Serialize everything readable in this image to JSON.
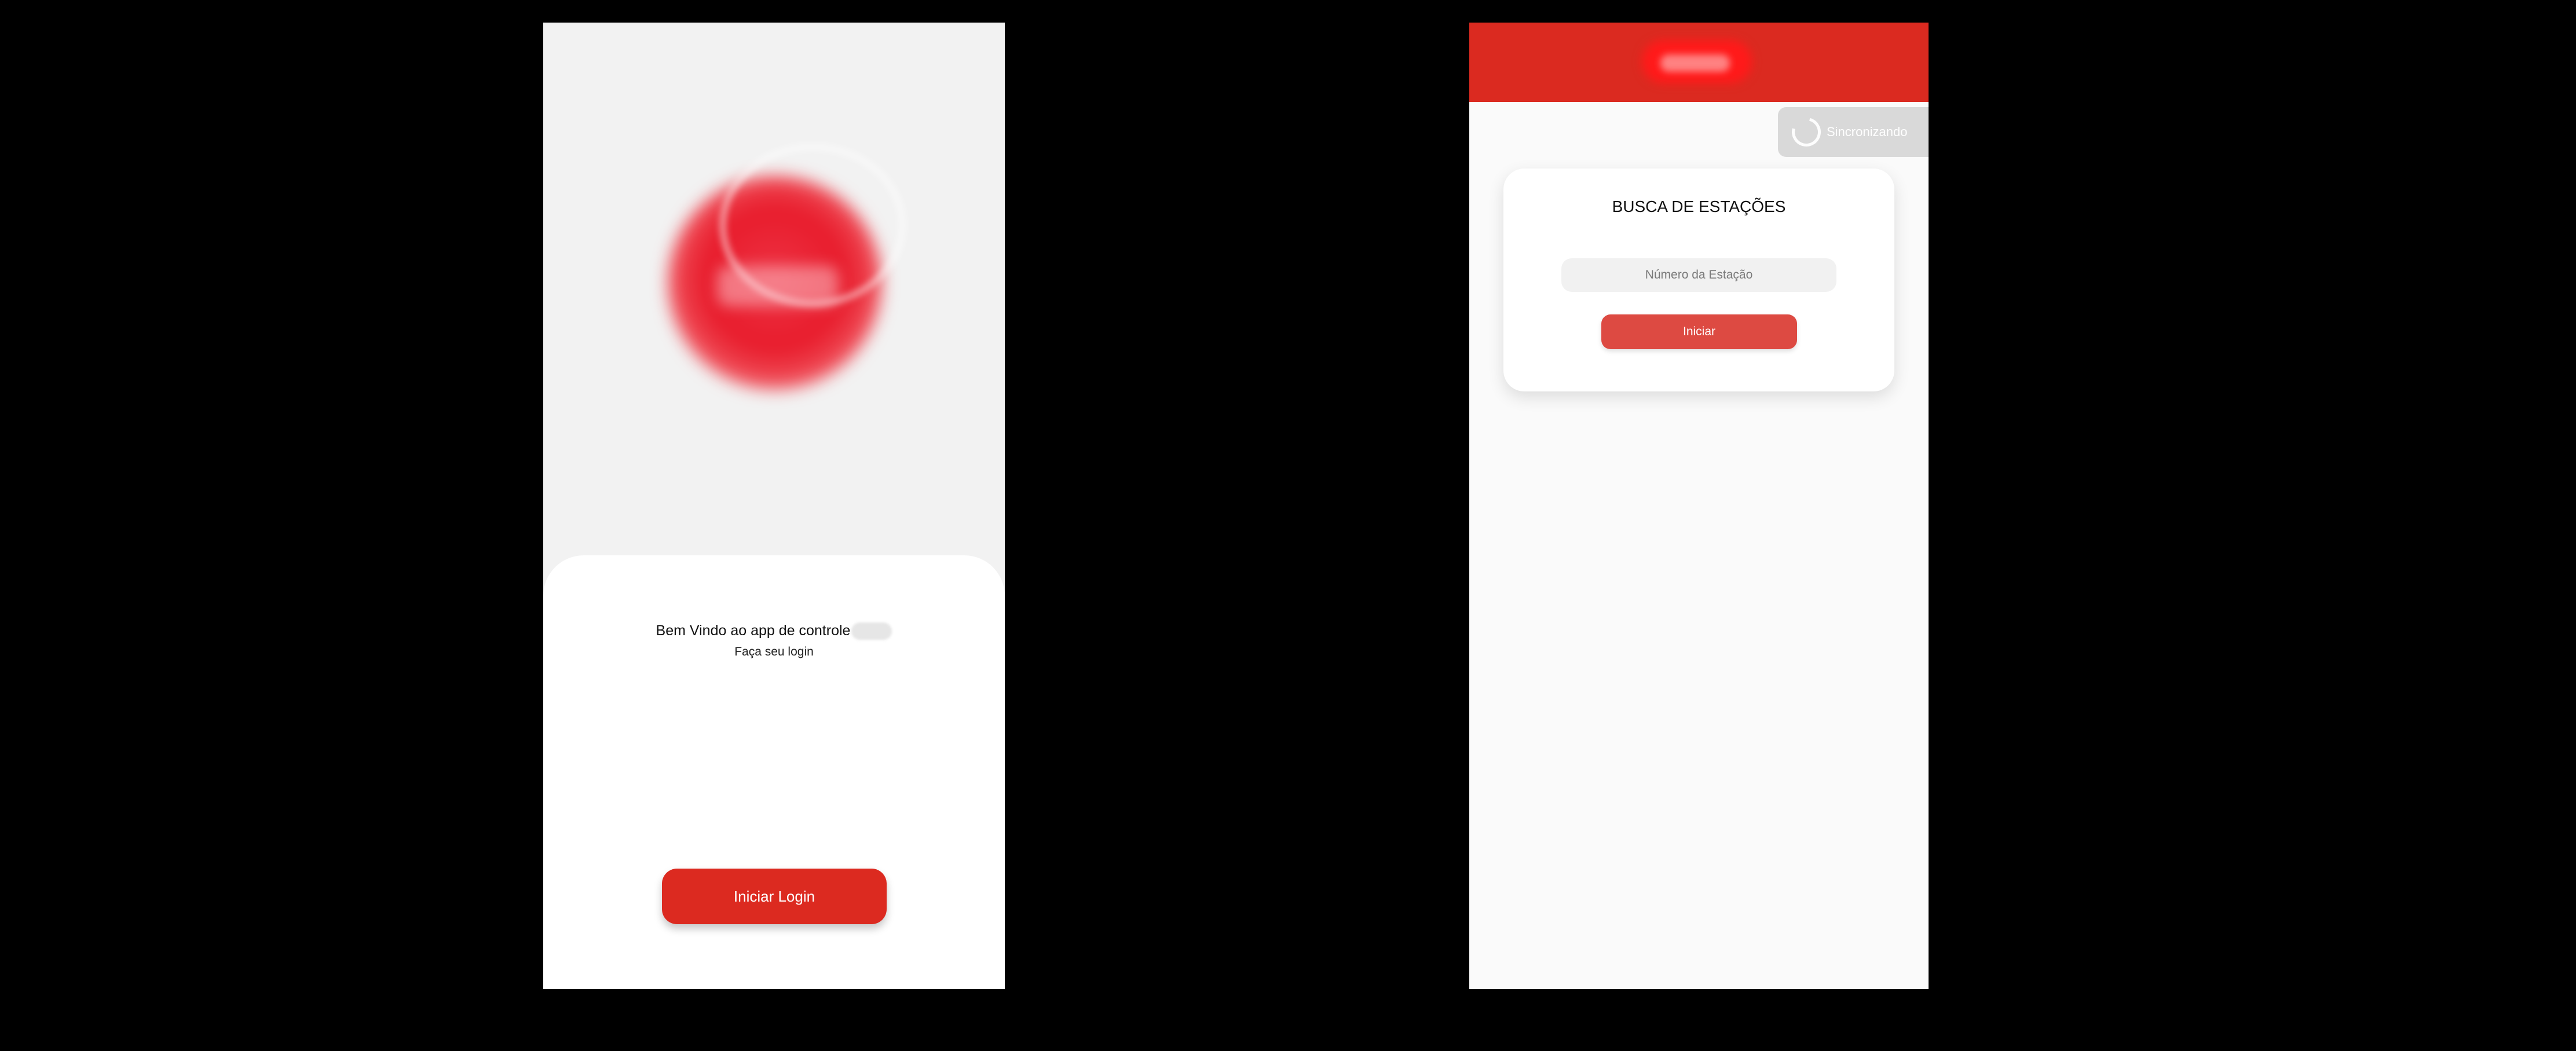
{
  "login_screen": {
    "welcome_text": "Bem Vindo ao app de controle",
    "subtitle": "Faça seu login",
    "login_button_label": "Iniciar Login"
  },
  "search_screen": {
    "sync_status": "Sincronizando",
    "card_title": "BUSCA DE ESTAÇÕES",
    "station_input": {
      "placeholder": "Número da Estação",
      "value": ""
    },
    "start_button_label": "Iniciar"
  },
  "icons": {
    "logo": "app-logo-blurred",
    "brand": "brand-logo-blurred",
    "sync": "sync-spinner-icon"
  },
  "colors": {
    "brand_red": "#db2a20",
    "button_red": "#dc2a20",
    "start_button": "#dd4a42",
    "login_background": "#f2f2f2"
  }
}
